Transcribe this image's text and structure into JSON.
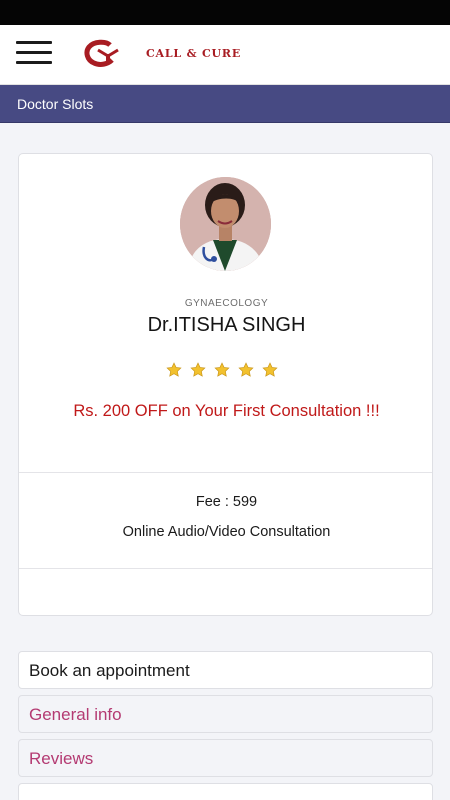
{
  "header": {
    "menu_icon": "hamburger-menu-icon",
    "logo_text": "CALL & CURE",
    "logo_color": "#a81c22"
  },
  "subbar": {
    "title": "Doctor Slots",
    "background": "#474a83"
  },
  "doctor": {
    "specialty": "GYNAECOLOGY",
    "name": "Dr.ITISHA SINGH",
    "rating": 5,
    "rating_max": 5,
    "offer": "Rs. 200 OFF on Your First Consultation !!!",
    "fee": "Fee : 599",
    "consultation_type": "Online Audio/Video Consultation"
  },
  "sections": {
    "book": "Book an appointment",
    "general_info": "General info",
    "reviews": "Reviews"
  },
  "colors": {
    "offer_text": "#c01919",
    "section_link": "#b43a72",
    "star": "#f2c12e"
  }
}
